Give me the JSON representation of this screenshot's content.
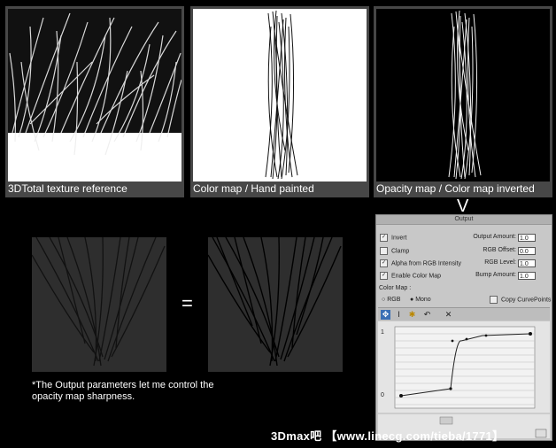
{
  "panels": [
    {
      "caption": "3DTotal texture reference"
    },
    {
      "caption": "Color map / Hand painted"
    },
    {
      "caption": "Opacity map / Color map inverted"
    }
  ],
  "equals_sign": "=",
  "arrow": "V",
  "note": "*The Output parameters let me control the opacity map sharpness.",
  "output_panel": {
    "title": "Output",
    "invert": "Invert",
    "clamp": "Clamp",
    "alpha_from_rgb": "Alpha from RGB Intensity",
    "enable_color_map": "Enable Color Map",
    "output_amount_label": "Output Amount:",
    "output_amount": "1.0",
    "rgb_offset_label": "RGB Offset:",
    "rgb_offset": "0.0",
    "rgb_level_label": "RGB Level:",
    "rgb_level": "1.0",
    "bump_amount_label": "Bump Amount:",
    "bump_amount": "1.0",
    "color_map_label": "Color Map :",
    "rgb_option": "RGB",
    "mono_option": "Mono",
    "copy_curve_points": "Copy CurvePoints",
    "graph_top": "1",
    "graph_bottom": "0"
  },
  "watermark": "3Dmax吧 【www.linecg.com/tieba/1771】"
}
